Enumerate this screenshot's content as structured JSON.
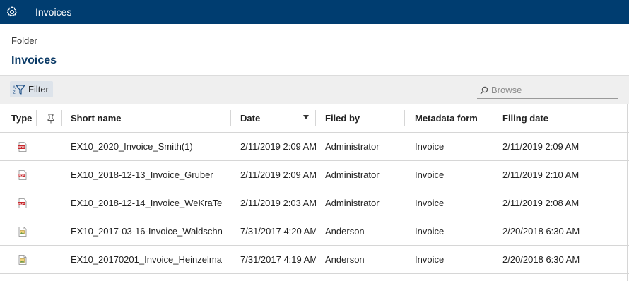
{
  "topbar": {
    "title": "Invoices",
    "icon": "gear-icon",
    "color": "#003d70"
  },
  "breadcrumb": "Folder",
  "page_title": "Invoices",
  "toolbar": {
    "filter_label": "Filter",
    "search_placeholder": "Browse"
  },
  "columns": {
    "type": "Type",
    "name": "Short name",
    "date": "Date",
    "filed_by": "Filed by",
    "metadata_form": "Metadata form",
    "filing_date": "Filing date"
  },
  "rows": [
    {
      "icon": "pdf-file-icon",
      "name": "EX10_2020_Invoice_Smith(1)",
      "date": "2/11/2019 2:09 AM",
      "filed_by": "Administrator",
      "metadata_form": "Invoice",
      "filing_date": "2/11/2019 2:09 AM"
    },
    {
      "icon": "pdf-file-icon",
      "name": "EX10_2018-12-13_Invoice_Gruber",
      "date": "2/11/2019 2:09 AM",
      "filed_by": "Administrator",
      "metadata_form": "Invoice",
      "filing_date": "2/11/2019 2:10 AM"
    },
    {
      "icon": "pdf-file-icon",
      "name": "EX10_2018-12-14_Invoice_WeKraTe",
      "date": "2/11/2019 2:03 AM",
      "filed_by": "Administrator",
      "metadata_form": "Invoice",
      "filing_date": "2/11/2019 2:08 AM"
    },
    {
      "icon": "image-file-icon",
      "name": "EX10_2017-03-16-Invoice_Waldschn",
      "date": "7/31/2017 4:20 AM",
      "filed_by": "Anderson",
      "metadata_form": "Invoice",
      "filing_date": "2/20/2018 6:30 AM"
    },
    {
      "icon": "image-file-icon",
      "name": "EX10_20170201_Invoice_Heinzelma",
      "date": "7/31/2017 4:19 AM",
      "filed_by": "Anderson",
      "metadata_form": "Invoice",
      "filing_date": "2/20/2018 6:30 AM"
    }
  ]
}
